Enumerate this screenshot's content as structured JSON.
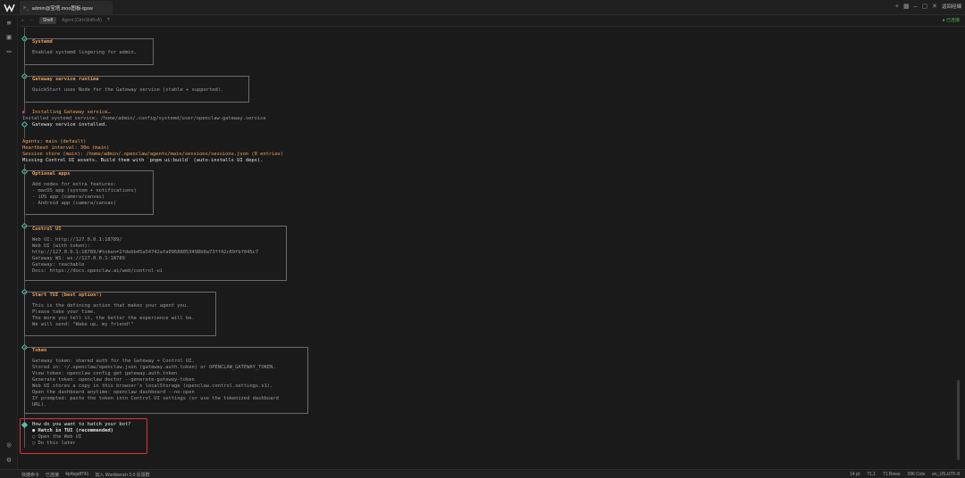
{
  "titlebar": {
    "tab_title": "admin@宝塔.moo图板-tgow",
    "term_icon": ">_",
    "right_label": "返回经编"
  },
  "toolbar2": {
    "pill": "Shell",
    "agent_label": "Agent (Ctrl+Shift+A)",
    "right_status": "● 已连接"
  },
  "statusbar": {
    "left": [
      "快捷命令",
      "已连接",
      "4phbgdf741",
      "加入 Workbench 2.0 反馈群"
    ],
    "right": [
      "14 pt",
      "71,1",
      "71 Rows",
      "296 Cols",
      "en_US.UTF-8"
    ]
  },
  "terminal": {
    "systemd": {
      "title": "Systemd",
      "lines": [
        "Enabled systemd lingering for admin."
      ]
    },
    "gateway_runtime": {
      "title": "Gateway service runtime",
      "lines": [
        "QuickStart uses Node for the Gateway service (stable + supported)."
      ]
    },
    "installing": "Installing Gateway service…",
    "installed_path": "Installed systemd service: /home/admin/.config/systemd/user/openclaw-gateway.service",
    "installed_ok": "Gateway service installed.",
    "agents": "Agents: main (default)",
    "heartbeat": "Heartbeat interval: 30m (main)",
    "session_store": "Session store (main): /home/admin/.openclaw/agents/main/sessions/sessions.json (0 entries)",
    "missing_ui": "Missing Control UI assets. Build them with `pnpm ui:build` (auto-installs UI deps).",
    "optional_apps": {
      "title": "Optional apps",
      "lines": [
        "Add nodes for extra features:",
        "- macOS app (system + notifications)",
        "- iOS app (camera/canvas)",
        "- Android app (camera/canvas)"
      ]
    },
    "control_ui": {
      "title": "Control UI",
      "lines": [
        "Web UI: http://127.0.0.1:18789/",
        "Web UI (with token):",
        "http://127.0.0.1:18789/#token=2fdebb45a54742afa09688053498b0a73ff42c69fbf045c7",
        "Gateway WS: ws://127.0.0.1:18789",
        "Gateway: reachable",
        "Docs: https://docs.openclaw.ai/web/control-ui"
      ]
    },
    "start_tui": {
      "title": "Start TUI (best option!)",
      "lines": [
        "This is the defining action that makes your agent you.",
        "Please take your time.",
        "The more you tell it, the better the experience will be.",
        "We will send: \"Wake up, my friend!\""
      ]
    },
    "token": {
      "title": "Token",
      "lines": [
        "Gateway token: shared auth for the Gateway + Control UI.",
        "Stored in: ~/.openclaw/openclaw.json (gateway.auth.token) or OPENCLAW_GATEWAY_TOKEN.",
        "View token: openclaw config get gateway.auth.token",
        "Generate token: openclaw doctor --generate-gateway-token",
        "Web UI stores a copy in this browser's localStorage (openclaw.control.settings.v1).",
        "Open the dashboard anytime: openclaw dashboard --no-open",
        "If prompted: paste the token into Control UI settings (or use the tokenized dashboard",
        "URL)."
      ]
    },
    "question": "How do you want to hatch your bot?",
    "options": [
      "● Hatch in TUI (recommended)",
      "○ Open the Web UI",
      "○ Do this later"
    ]
  },
  "colors": {
    "accent_orange": "#f0a15a",
    "accent_teal": "#4fc3b0",
    "highlight_red": "#e0333a"
  }
}
